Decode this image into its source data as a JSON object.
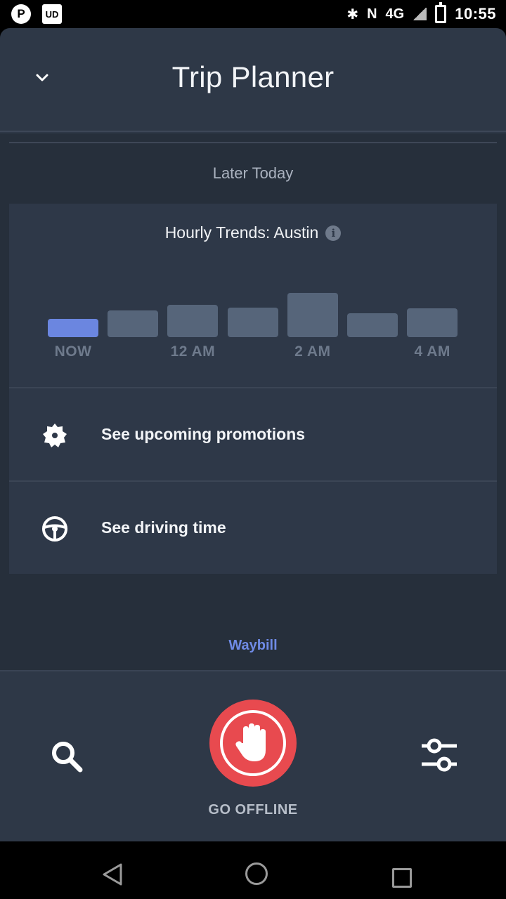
{
  "status_bar": {
    "time": "10:55",
    "network": "4G",
    "left_icons": [
      "p-app-icon",
      "ud-app-icon"
    ],
    "right_icons": [
      "bluetooth-icon",
      "nfc-icon",
      "network-icon",
      "signal-icon",
      "battery-charging-icon"
    ]
  },
  "header": {
    "title": "Trip Planner",
    "collapse_icon": "chevron-down-icon"
  },
  "section": {
    "label": "Later Today"
  },
  "trends": {
    "title": "Hourly Trends: Austin",
    "info_icon": "info-icon",
    "info_glyph": "i",
    "active_color": "#6b86e0",
    "bar_color": "#56657a"
  },
  "chart_data": {
    "type": "bar",
    "categories": [
      "NOW",
      "",
      "12 AM",
      "",
      "2 AM",
      "",
      "4 AM"
    ],
    "values": [
      26,
      38,
      46,
      42,
      63,
      34,
      41
    ],
    "tick_labels": [
      "NOW",
      "12 AM",
      "2 AM",
      "4 AM"
    ],
    "highlighted_index": 0
  },
  "menu": {
    "items": [
      {
        "label": "See upcoming promotions",
        "icon": "promotion-badge-icon"
      },
      {
        "label": "See driving time",
        "icon": "steering-wheel-icon"
      }
    ]
  },
  "waybill": {
    "label": "Waybill",
    "color": "#6f8be6"
  },
  "bottom_bar": {
    "search_icon": "search-icon",
    "offline_label": "GO OFFLINE",
    "offline_icon": "hand-stop-icon",
    "offline_color": "#e84a4f",
    "filter_icon": "sliders-icon"
  },
  "nav_bar": {
    "icons": [
      "back-icon",
      "home-icon",
      "recents-icon"
    ]
  }
}
